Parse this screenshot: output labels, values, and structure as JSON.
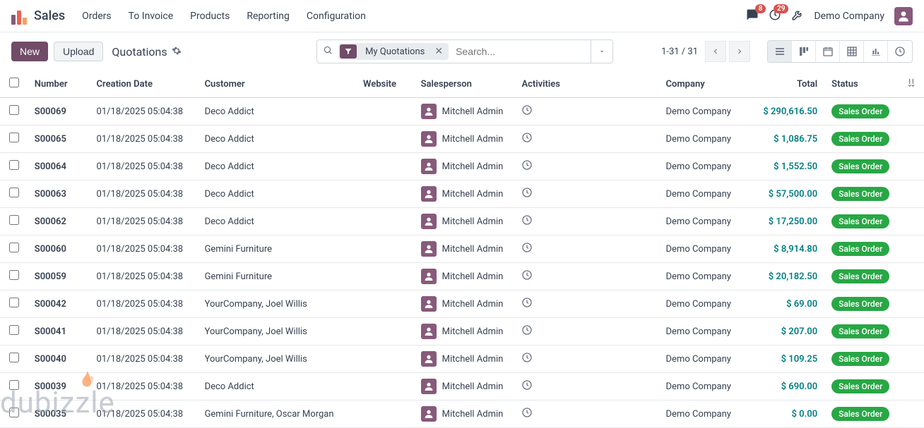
{
  "nav": {
    "app": "Sales",
    "links": [
      "Orders",
      "To Invoice",
      "Products",
      "Reporting",
      "Configuration"
    ],
    "messages_badge": "8",
    "activities_badge": "29",
    "company": "Demo Company"
  },
  "controls": {
    "new_label": "New",
    "upload_label": "Upload",
    "breadcrumb": "Quotations",
    "filter_chip": "My Quotations",
    "search_placeholder": "Search...",
    "pager": "1-31 / 31"
  },
  "columns": {
    "number": "Number",
    "date": "Creation Date",
    "customer": "Customer",
    "website": "Website",
    "salesperson": "Salesperson",
    "activities": "Activities",
    "company": "Company",
    "total": "Total",
    "status": "Status"
  },
  "rows": [
    {
      "num": "S00069",
      "date": "01/18/2025 05:04:38",
      "cust": "Deco Addict",
      "sp": "Mitchell Admin",
      "comp": "Demo Company",
      "total": "$ 290,616.50",
      "status": "Sales Order"
    },
    {
      "num": "S00065",
      "date": "01/18/2025 05:04:38",
      "cust": "Deco Addict",
      "sp": "Mitchell Admin",
      "comp": "Demo Company",
      "total": "$ 1,086.75",
      "status": "Sales Order"
    },
    {
      "num": "S00064",
      "date": "01/18/2025 05:04:38",
      "cust": "Deco Addict",
      "sp": "Mitchell Admin",
      "comp": "Demo Company",
      "total": "$ 1,552.50",
      "status": "Sales Order"
    },
    {
      "num": "S00063",
      "date": "01/18/2025 05:04:38",
      "cust": "Deco Addict",
      "sp": "Mitchell Admin",
      "comp": "Demo Company",
      "total": "$ 57,500.00",
      "status": "Sales Order"
    },
    {
      "num": "S00062",
      "date": "01/18/2025 05:04:38",
      "cust": "Deco Addict",
      "sp": "Mitchell Admin",
      "comp": "Demo Company",
      "total": "$ 17,250.00",
      "status": "Sales Order"
    },
    {
      "num": "S00060",
      "date": "01/18/2025 05:04:38",
      "cust": "Gemini Furniture",
      "sp": "Mitchell Admin",
      "comp": "Demo Company",
      "total": "$ 8,914.80",
      "status": "Sales Order"
    },
    {
      "num": "S00059",
      "date": "01/18/2025 05:04:38",
      "cust": "Gemini Furniture",
      "sp": "Mitchell Admin",
      "comp": "Demo Company",
      "total": "$ 20,182.50",
      "status": "Sales Order"
    },
    {
      "num": "S00042",
      "date": "01/18/2025 05:04:38",
      "cust": "YourCompany, Joel Willis",
      "sp": "Mitchell Admin",
      "comp": "Demo Company",
      "total": "$ 69.00",
      "status": "Sales Order"
    },
    {
      "num": "S00041",
      "date": "01/18/2025 05:04:38",
      "cust": "YourCompany, Joel Willis",
      "sp": "Mitchell Admin",
      "comp": "Demo Company",
      "total": "$ 207.00",
      "status": "Sales Order"
    },
    {
      "num": "S00040",
      "date": "01/18/2025 05:04:38",
      "cust": "YourCompany, Joel Willis",
      "sp": "Mitchell Admin",
      "comp": "Demo Company",
      "total": "$ 109.25",
      "status": "Sales Order"
    },
    {
      "num": "S00039",
      "date": "01/18/2025 05:04:38",
      "cust": "Deco Addict",
      "sp": "Mitchell Admin",
      "comp": "Demo Company",
      "total": "$ 690.00",
      "status": "Sales Order"
    },
    {
      "num": "S00035",
      "date": "01/18/2025 05:04:38",
      "cust": "Gemini Furniture, Oscar Morgan",
      "sp": "Mitchell Admin",
      "comp": "Demo Company",
      "total": "$ 0.00",
      "status": "Sales Order"
    }
  ],
  "watermark": "dubizzle"
}
